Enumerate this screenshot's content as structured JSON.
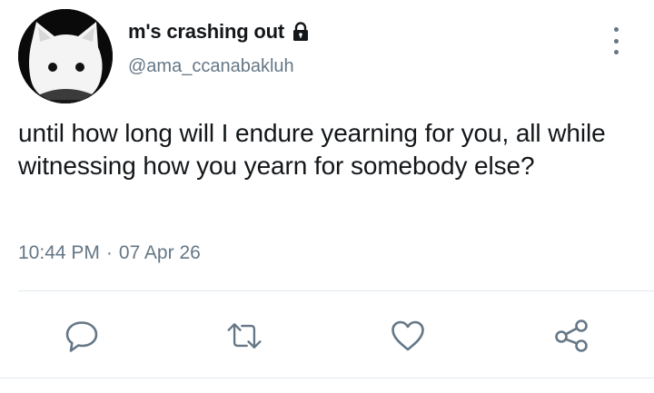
{
  "tweet": {
    "display_name": "m's crashing out",
    "handle": "@ama_ccanabakluh",
    "text": "until how long will I endure yearning for you, all while witnessing how you yearn for somebody else?",
    "time": "10:44 PM",
    "separator": "·",
    "date": "07 Apr 26"
  },
  "icons": {
    "lock": "lock-icon",
    "more": "more-vertical-icon",
    "reply": "reply-icon",
    "retweet": "retweet-icon",
    "like": "heart-icon",
    "share": "share-icon"
  },
  "colors": {
    "text": "#14171a",
    "secondary": "#657786",
    "divider": "#e1e8ed",
    "icon": "#657786"
  }
}
